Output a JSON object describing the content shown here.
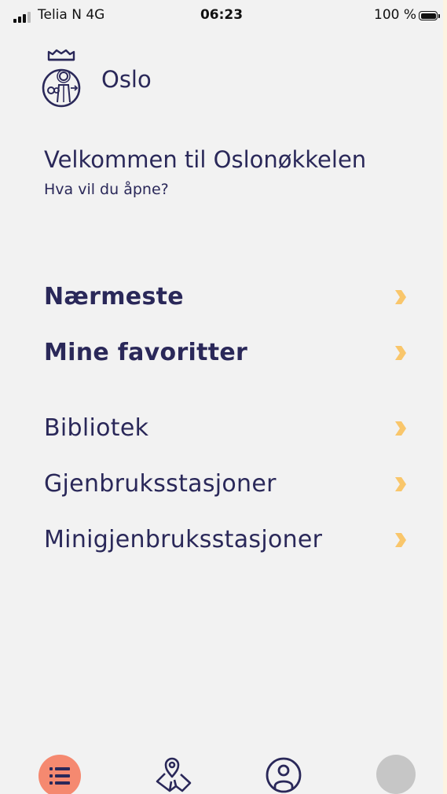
{
  "status_bar": {
    "carrier": "Telia N  4G",
    "time": "06:23",
    "battery_percent": "100 %",
    "battery_level": 1.0,
    "signal_bars": 3
  },
  "header": {
    "brand_name": "Oslo",
    "logo_icon": "oslo-city-seal-icon"
  },
  "welcome": {
    "title": "Velkommen til Oslonøkkelen",
    "subtitle": "Hva vil du åpne?"
  },
  "menu": {
    "items": [
      {
        "label": "Nærmeste",
        "emphasis": "bold",
        "icon": "chevron-right-icon"
      },
      {
        "label": "Mine favoritter",
        "emphasis": "bold",
        "icon": "chevron-right-icon"
      },
      {
        "label": "Bibliotek",
        "emphasis": "regular",
        "icon": "chevron-right-icon"
      },
      {
        "label": "Gjenbruksstasjoner",
        "emphasis": "regular",
        "icon": "chevron-right-icon"
      },
      {
        "label": "Minigjenbruksstasjoner",
        "emphasis": "regular",
        "icon": "chevron-right-icon"
      }
    ]
  },
  "tab_bar": {
    "tabs": [
      {
        "icon": "list-icon",
        "active": true
      },
      {
        "icon": "map-pin-icon",
        "active": false
      },
      {
        "icon": "profile-icon",
        "active": false
      },
      {
        "icon": "avatar-icon",
        "active": false
      }
    ]
  },
  "colors": {
    "text": "#2a2859",
    "background": "#f2f2f2",
    "chevron": "#f9c66b",
    "active_tab": "#f58970",
    "avatar": "#c6c6c6"
  }
}
